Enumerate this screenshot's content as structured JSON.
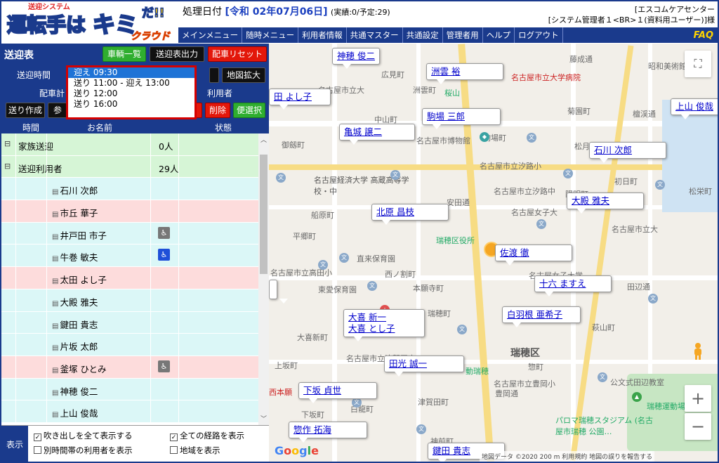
{
  "logo": {
    "tag": "送迎システム",
    "main": "運転手は",
    "kimi": "キミ",
    "da": "だ!!",
    "cloud": "クラウド"
  },
  "header": {
    "date_prefix": "処理日付",
    "date_value": "[令和 02年07月06日]",
    "stats": "(実績:0/予定:29)",
    "org": "[エスコムケアセンター",
    "user": "[システム管理者１<BR>１(資料用ユーザー)]様"
  },
  "menu": [
    {
      "label": "メインメニュー"
    },
    {
      "label": "随時メニュー"
    },
    {
      "label": "利用者情報"
    },
    {
      "label": "共通マスター"
    },
    {
      "label": "共通設定"
    },
    {
      "label": "管理者用"
    },
    {
      "label": "ヘルプ"
    },
    {
      "label": "ログアウト"
    }
  ],
  "faq": "FAQ",
  "left": {
    "title": "送迎表",
    "btn_vehicles": "車輌一覧",
    "btn_export": "送迎表出力",
    "btn_reset": "配車リセット",
    "time_label": "送迎時間",
    "btn_map_zoom": "地図拡大",
    "col_plan": "配車計",
    "col_user": "利用者",
    "btn_create": "送り作成",
    "btn_ref": "参",
    "btn_delete": "削除",
    "btn_convenience": "便選択",
    "grid_cols": {
      "time": "時間",
      "name": "お名前",
      "status": "状態"
    },
    "groups": [
      {
        "name": "家族送迎",
        "count": "0人"
      },
      {
        "name": "送迎利用者",
        "count": "29人"
      }
    ],
    "rows": [
      {
        "name": "石川 次郎",
        "icon": ""
      },
      {
        "name": "市丘 華子",
        "icon": ""
      },
      {
        "name": "井戸田 市子",
        "icon": "walker"
      },
      {
        "name": "牛巻 敏夫",
        "icon": "wheelchair"
      },
      {
        "name": "太田 よし子",
        "icon": ""
      },
      {
        "name": "大殿 雅夫",
        "icon": ""
      },
      {
        "name": "鍵田 貴志",
        "icon": ""
      },
      {
        "name": "片坂 太郎",
        "icon": ""
      },
      {
        "name": "釜塚 ひとみ",
        "icon": "walker"
      },
      {
        "name": "神穂 俊二",
        "icon": ""
      },
      {
        "name": "上山 俊哉",
        "icon": ""
      }
    ],
    "bottom_label": "表示",
    "opt_show_all_bubbles": "吹き出しを全て表示する",
    "opt_show_all_routes": "全ての経路を表示",
    "opt_other_time": "別時間帯の利用者を表示",
    "opt_area": "地域を表示"
  },
  "dropdown": {
    "options": [
      "迎え 09:30",
      "送り 11:00 - 迎え 13:00",
      "送り 12:00",
      "送り 16:00"
    ],
    "selected_index": 0
  },
  "map": {
    "labels": [
      "広見町",
      "藤成通",
      "名古屋市立大",
      "名古屋市立大学病院",
      "昭和美術館",
      "洲雲町",
      "桜山",
      "菊園町",
      "檀渓通",
      "中山町",
      "駒場町",
      "名古屋市博物館",
      "御劔町",
      "名古屋市立汐路小",
      "松月町",
      "初日町",
      "松栄町",
      "名古屋経済大学 高蔵高等学校・中",
      "安田通",
      "名古屋市立汐路中",
      "陽明町",
      "名古屋女子大",
      "船原町",
      "瑞穂区役所",
      "名古屋市立大",
      "平郷町",
      "直来保育園",
      "西ノ割町",
      "名古屋女子大学",
      "名古屋市立高田小",
      "本願寺町",
      "東愛保育園",
      "田辺通",
      "大喜新町",
      "瑞穂町",
      "萩山町",
      "瑞穂区",
      "上坂町",
      "名古屋市立津賀田中",
      "動瑞穂",
      "惣町",
      "名古屋市立豊岡小",
      "豊岡通",
      "公文式田辺教室",
      "西本願",
      "下坂町",
      "白龍町",
      "津賀田町",
      "瑞穂運動場",
      "パロマ瑞穂スタジアム (名古屋市瑞穂 公園…",
      "神前町"
    ],
    "bubbles": [
      {
        "text": [
          "神穂 俊二"
        ]
      },
      {
        "text": [
          "洲雲 裕"
        ]
      },
      {
        "text": [
          "田 よし子"
        ]
      },
      {
        "text": [
          "駒場 三郎"
        ]
      },
      {
        "text": [
          "上山 俊哉"
        ]
      },
      {
        "text": [
          "亀城 譲二"
        ]
      },
      {
        "text": [
          "石川 次郎"
        ]
      },
      {
        "text": [
          "大殿 雅夫"
        ]
      },
      {
        "text": [
          "北原 昌枝"
        ]
      },
      {
        "text": [
          "佐渡 徹"
        ]
      },
      {
        "text": [
          "十六 ますえ"
        ]
      },
      {
        "text": [
          "大喜 新一",
          "大喜 とし子"
        ]
      },
      {
        "text": [
          "白羽根 亜希子"
        ]
      },
      {
        "text": [
          "田光 誠一"
        ]
      },
      {
        "text": [
          "下坂 貞世"
        ]
      },
      {
        "text": [
          "惣作 拓海"
        ]
      },
      {
        "text": [
          "鍵田 貴志"
        ]
      }
    ],
    "google": "Google",
    "footer": "地図データ ©2020 200 m 利用規約 地図の誤りを報告する"
  }
}
